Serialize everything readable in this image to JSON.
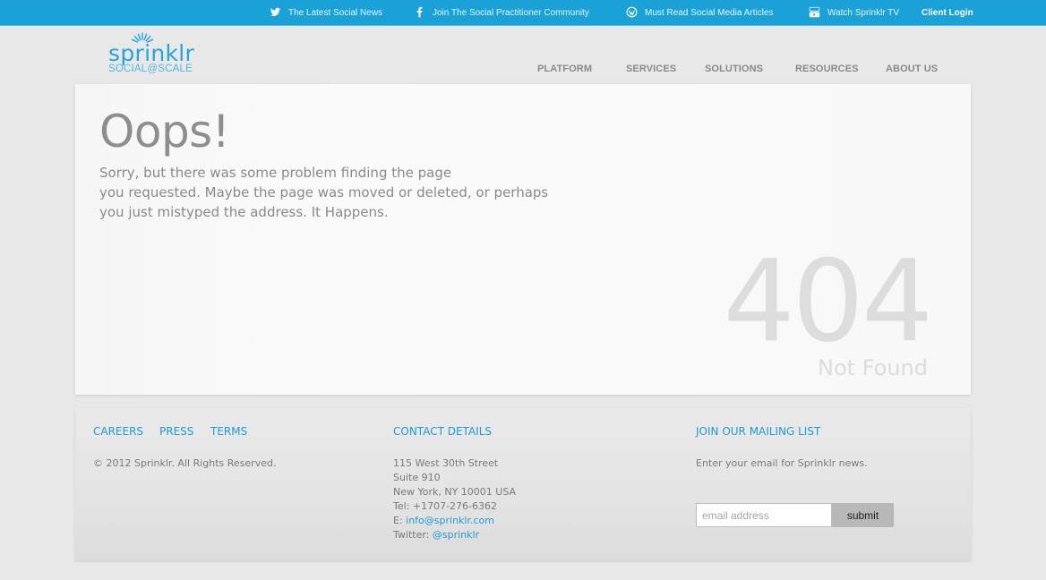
{
  "topbar": {
    "items": [
      {
        "label": "The Latest Social News",
        "icon": "twitter-icon"
      },
      {
        "label": "Join The Social Practitioner Community",
        "icon": "facebook-icon"
      },
      {
        "label": "Must Read Social Media Articles",
        "icon": "wordpress-icon"
      },
      {
        "label": "Watch Sprinklr TV",
        "icon": "youtube-icon"
      }
    ],
    "client_login": "Client Login",
    "color": "#1aa1d8"
  },
  "logo": {
    "wordmark": "sprinklr",
    "tagline": "SOCIAL@SCALE"
  },
  "nav": {
    "items": [
      "PLATFORM",
      "SERVICES",
      "SOLUTIONS",
      "RESOURCES",
      "ABOUT US"
    ]
  },
  "error": {
    "heading": "Oops!",
    "message_lines": [
      "Sorry, but there was some problem finding the page",
      "you requested. Maybe the page was moved or deleted, or perhaps",
      "you just mistyped the address. It Happens."
    ],
    "code": "404",
    "status_text": "Not Found"
  },
  "footer": {
    "links": [
      "CAREERS",
      "PRESS",
      "TERMS"
    ],
    "copyright": "© 2012 Sprinklr. All Rights Reserved.",
    "contact": {
      "heading": "CONTACT DETAILS",
      "street": "115 West 30th Street",
      "suite": "Suite 910",
      "city": "New York, NY 10001 USA",
      "tel": "Tel: +1707-276-6362",
      "email_label": "E: ",
      "email": "info@sprinklr.com",
      "twitter_label": "Twitter: ",
      "twitter": "@sprinklr"
    },
    "mailing": {
      "heading": "JOIN OUR MAILING LIST",
      "description": "Enter your email for Sprinklr news.",
      "placeholder": "email address",
      "submit_label": "submit"
    },
    "accent_color": "#1e9cd5"
  }
}
